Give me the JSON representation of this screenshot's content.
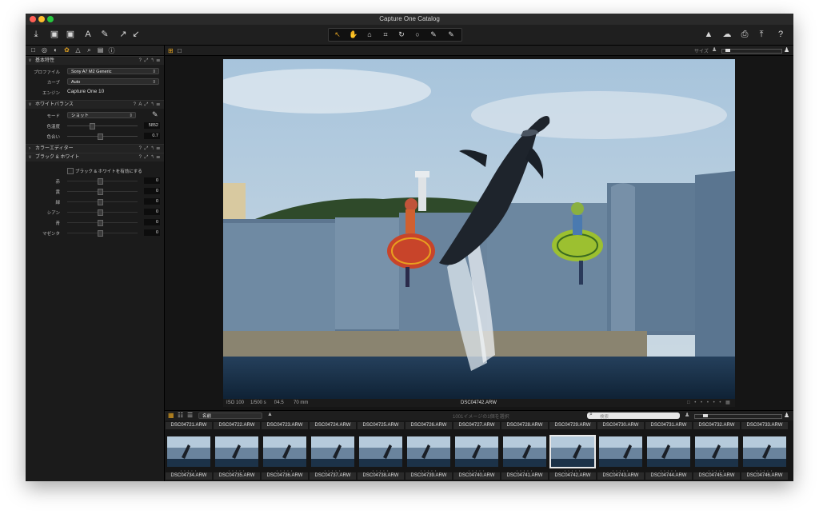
{
  "window": {
    "title": "Capture One Catalog"
  },
  "colors": {
    "close": "#ff5f56",
    "minimize": "#ffbd2e",
    "zoom": "#27c93f",
    "accent": "#e0a020"
  },
  "toolbar": {
    "left_icons": [
      "import-icon",
      "camera-icon",
      "capture-icon",
      "text-icon",
      "brush-icon",
      "rotate-icon",
      "expand-icon"
    ],
    "right_icons": [
      "warning-icon",
      "cloud-icon",
      "print-icon",
      "export-icon",
      "help-icon"
    ]
  },
  "viewer_bar": {
    "size_label": "サイズ"
  },
  "left_panel": {
    "basic": {
      "title": "基本特性",
      "profile_label": "プロファイル",
      "profile_value": "Sony A7 M2 Generic",
      "curve_label": "カーブ",
      "curve_value": "Auto",
      "engine_label": "エンジン",
      "engine_value": "Capture One 10"
    },
    "wb": {
      "title": "ホワイトバランス",
      "mode_label": "モード",
      "mode_value": "ショット",
      "temp_label": "色温度",
      "temp_value": "5852",
      "tint_label": "色合い",
      "tint_value": "0.7"
    },
    "color_editor": {
      "title": "カラーエディター"
    },
    "bw": {
      "title": "ブラック & ホワイト",
      "enable_label": "ブラック & ホワイトを有効にする",
      "channels": [
        {
          "label": "赤",
          "value": "0"
        },
        {
          "label": "黄",
          "value": "0"
        },
        {
          "label": "緑",
          "value": "0"
        },
        {
          "label": "シアン",
          "value": "0"
        },
        {
          "label": "青",
          "value": "0"
        },
        {
          "label": "マゼンタ",
          "value": "0"
        }
      ]
    }
  },
  "meta": {
    "iso": "ISO 100",
    "shutter": "1/500 s",
    "aperture": "f/4.5",
    "focal": "70 mm",
    "filename": "DSC04742.ARW"
  },
  "browser": {
    "sort_label": "名前",
    "count_text": "1001イメージの1個を選択",
    "search_placeholder": "検索",
    "top_names": [
      "DSC04721.ARW",
      "DSC04722.ARW",
      "DSC04723.ARW",
      "DSC04724.ARW",
      "DSC04725.ARW",
      "DSC04726.ARW",
      "DSC04727.ARW",
      "DSC04728.ARW",
      "DSC04729.ARW",
      "DSC04730.ARW",
      "DSC04731.ARW",
      "DSC04732.ARW",
      "DSC04733.ARW"
    ],
    "bottom_names": [
      "DSC04734.ARW",
      "DSC04735.ARW",
      "DSC04736.ARW",
      "DSC04737.ARW",
      "DSC04738.ARW",
      "DSC04739.ARW",
      "DSC04740.ARW",
      "DSC04741.ARW",
      "DSC04742.ARW",
      "DSC04743.ARW",
      "DSC04744.ARW",
      "DSC04745.ARW",
      "DSC04746.ARW"
    ]
  }
}
